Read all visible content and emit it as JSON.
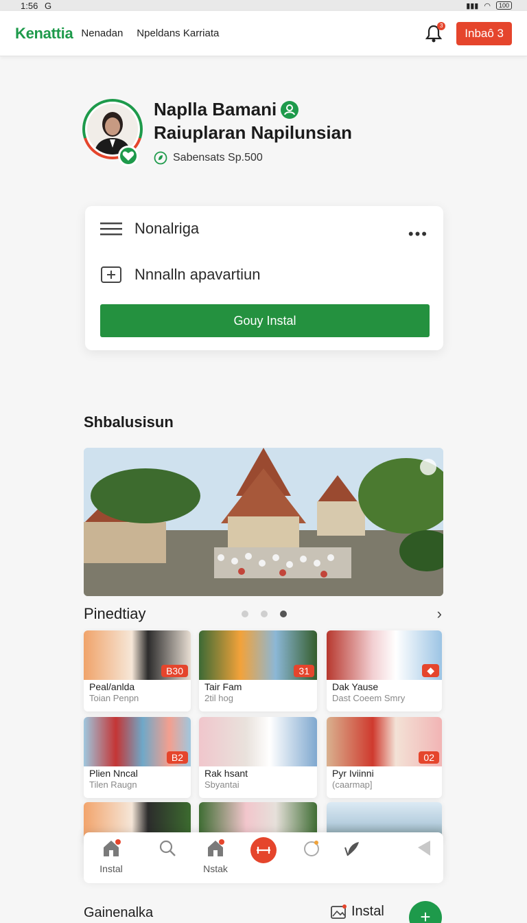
{
  "status_bar": {
    "time": "1:56",
    "carrier": "G",
    "battery": "100"
  },
  "nav": {
    "brand": "Kenattia",
    "links": [
      "Nenadan",
      "Npeldans Karriata"
    ],
    "notification_count": "3",
    "inbox_label": "Inbaô 3"
  },
  "profile": {
    "name": "Naplla Bamani",
    "subtitle": "Raiuplaran Napilunsian",
    "meta": "Sabensats Sp.500"
  },
  "card": {
    "menu_label": "Nonalriga",
    "add_label": "Nnnalln apavartiun",
    "button_label": "Gouy Instal"
  },
  "section_title": "Shbalusisun",
  "carousel": {
    "title": "Pinedtiay"
  },
  "grid": [
    {
      "title": "Peal/anlda",
      "sub": "Toian Penpn",
      "badge": "B30"
    },
    {
      "title": "Tair Fam",
      "sub": "2til hog",
      "badge": "31"
    },
    {
      "title": "Dak Yause",
      "sub": "Dast Coeem Smry",
      "badge": "◆"
    },
    {
      "title": "Plien Nncal",
      "sub": "Tilen Raugn",
      "badge": "B2"
    },
    {
      "title": "Rak hsant",
      "sub": "Sbyantai",
      "badge": ""
    },
    {
      "title": "Pyr Iviinni",
      "sub": "(caarmap]",
      "badge": "02"
    }
  ],
  "bottom_nav": {
    "home_label": "Instal",
    "store_label": "Nstak"
  },
  "footer": {
    "title": "Gainenalka",
    "action_label": "Instal",
    "fab": "+"
  },
  "colors": {
    "brand_green": "#1e9a4b",
    "accent_red": "#e5452c"
  }
}
